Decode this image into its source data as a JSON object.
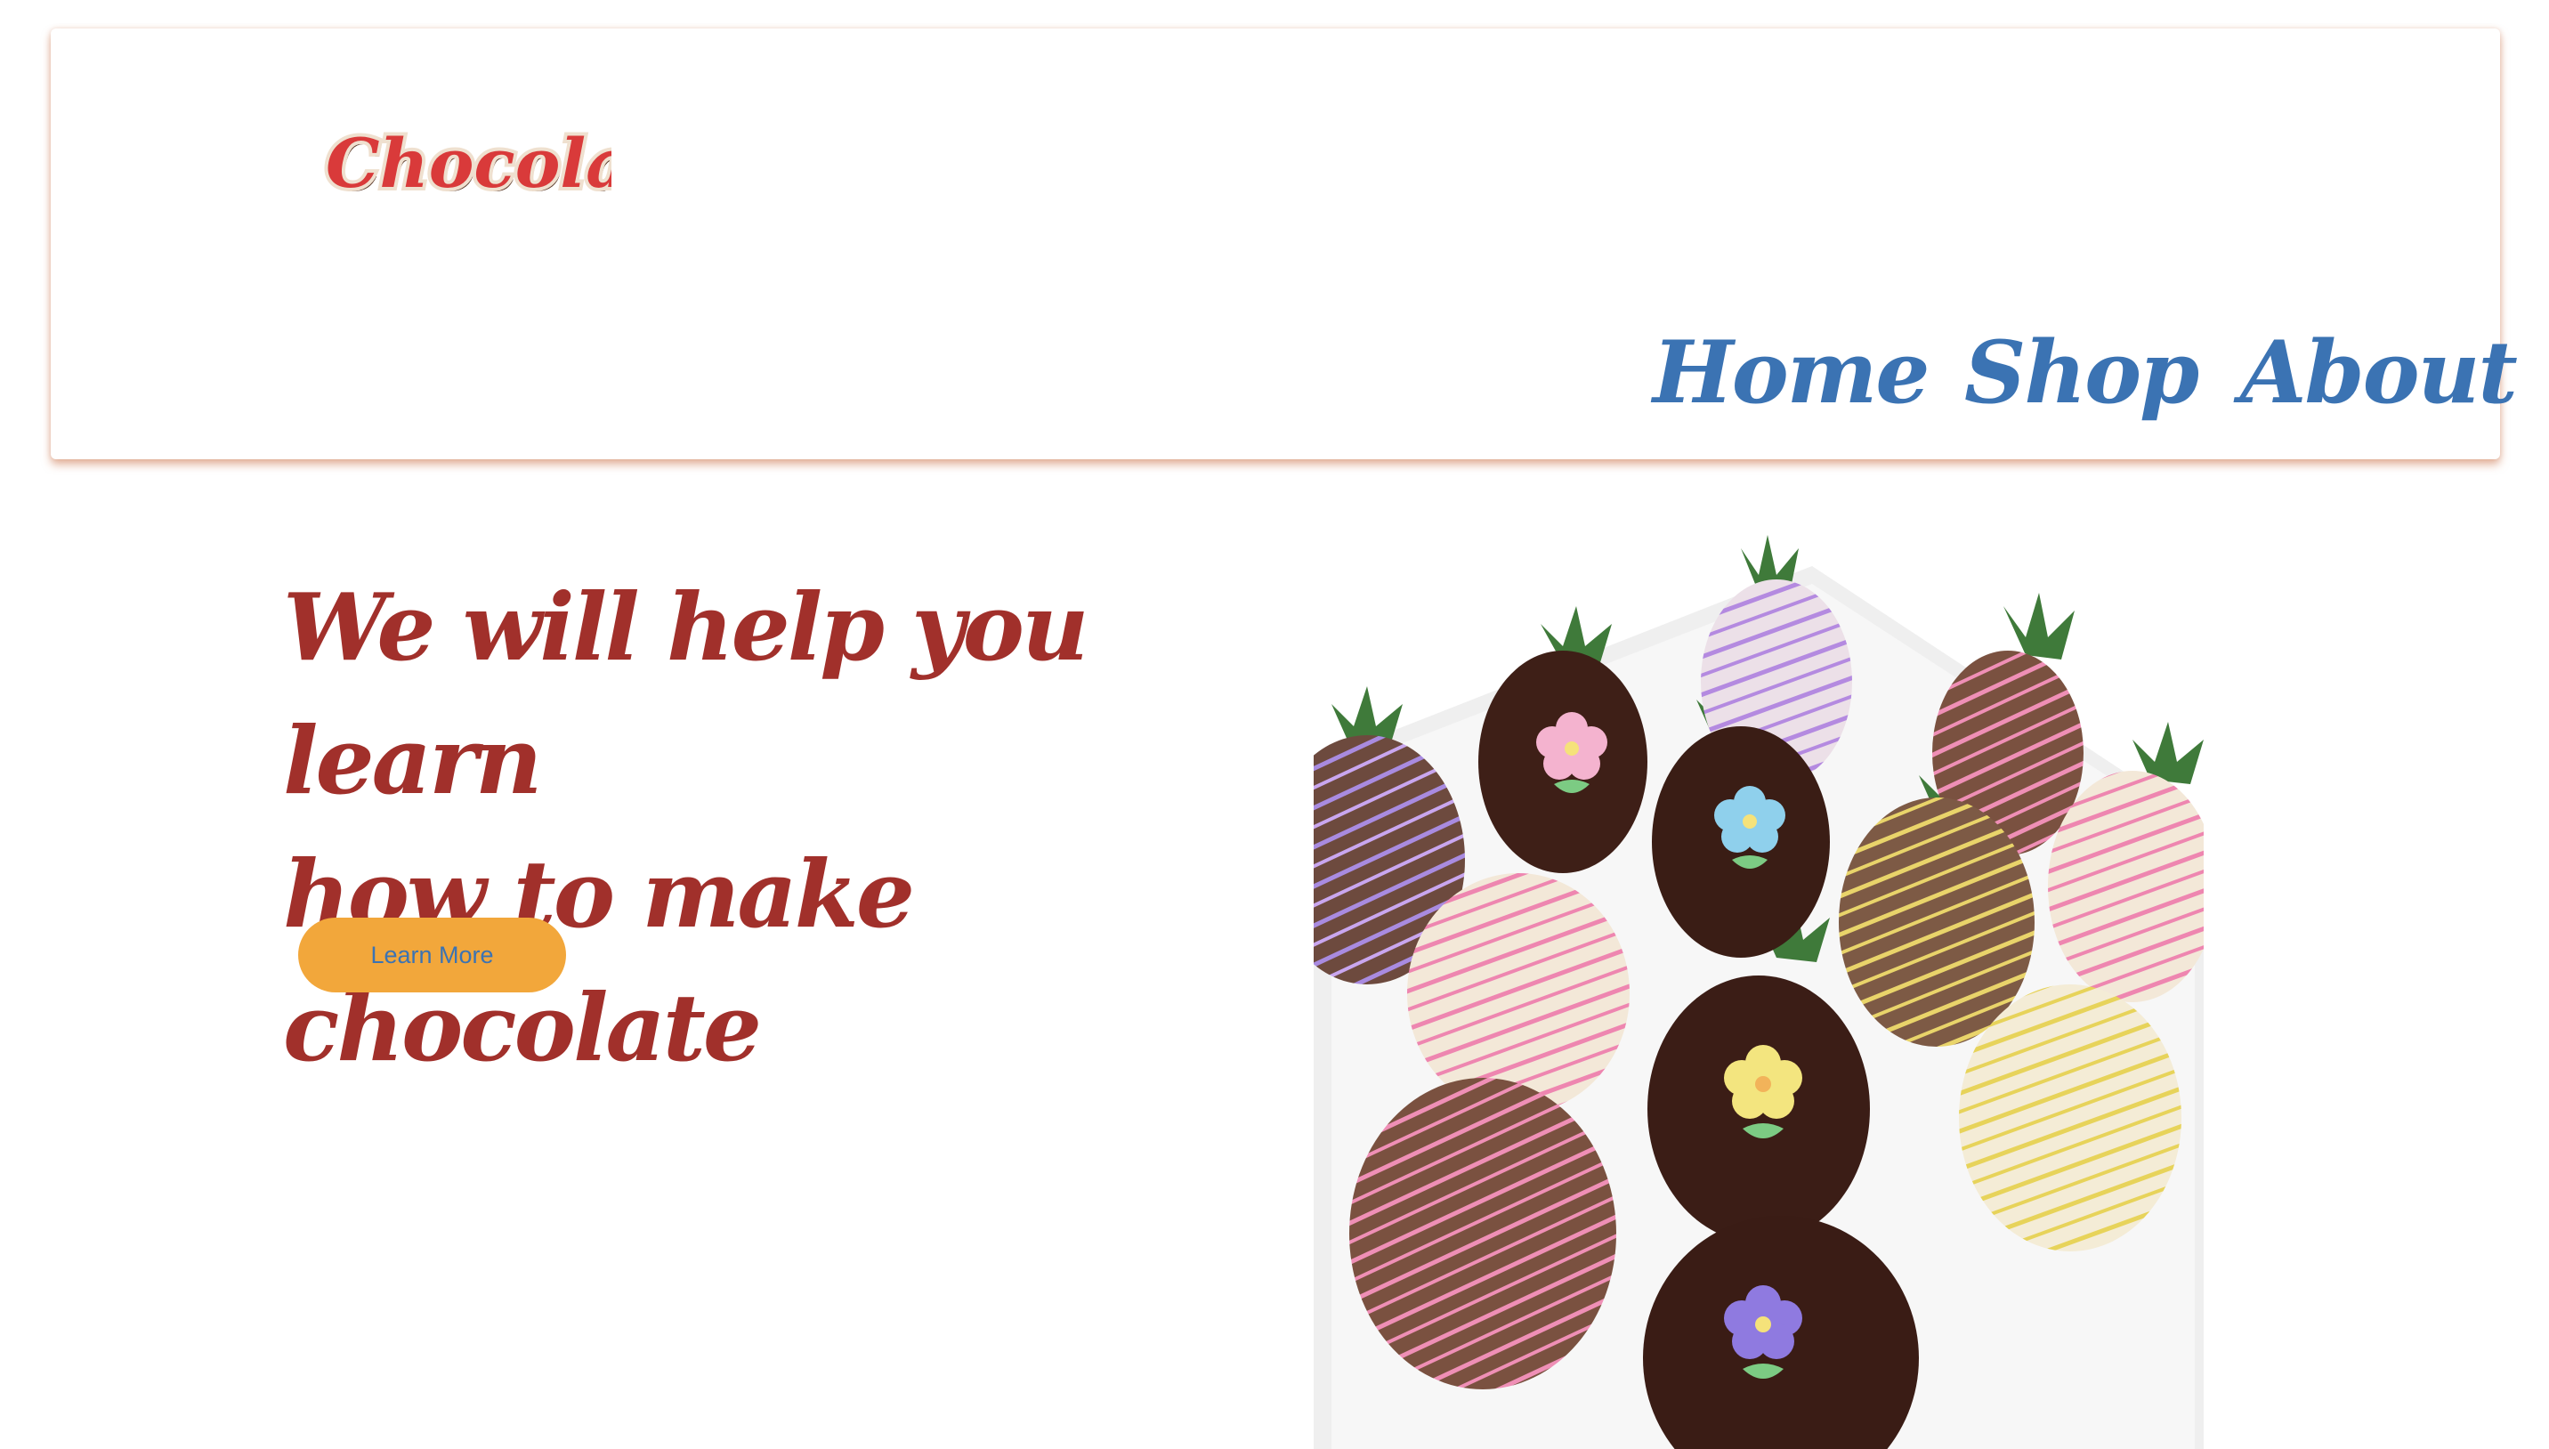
{
  "header": {
    "logo_text": "Chocolate",
    "nav": {
      "home": "Home",
      "shop": "Shop",
      "about": "About"
    }
  },
  "hero": {
    "title_line1": "We will help you learn",
    "title_line2": "how to make chocolate",
    "button_label": "Learn More"
  },
  "colors": {
    "nav_text": "#3b73b3",
    "title_text": "#a1302b",
    "button_bg": "#f2a73b",
    "header_shadow": "#cd7850",
    "logo_red": "#d93a3a"
  },
  "icons": {
    "logo": "chocolate-script-logo",
    "image": "chocolate-dipped-strawberries-photo"
  }
}
